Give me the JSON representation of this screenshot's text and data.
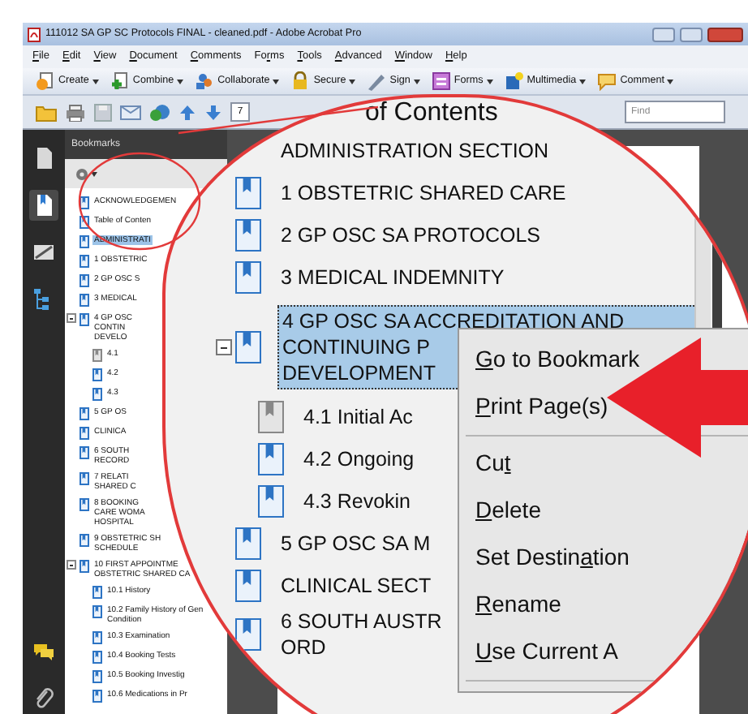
{
  "window": {
    "title": "111012 SA GP SC Protocols FINAL - cleaned.pdf - Adobe Acrobat Pro"
  },
  "menu": [
    {
      "accel_key": "F",
      "text_after": "ile"
    },
    {
      "accel_key": "E",
      "text_after": "dit"
    },
    {
      "accel_key": "V",
      "text_after": "iew"
    },
    {
      "accel_key": "D",
      "text_after": "ocument"
    },
    {
      "accel_key": "C",
      "text_after": "omments"
    },
    {
      "text_before": "Fo",
      "accel_key": "r",
      "text_after": "ms"
    },
    {
      "accel_key": "T",
      "text_after": "ools"
    },
    {
      "accel_key": "A",
      "text_after": "dvanced"
    },
    {
      "accel_key": "W",
      "text_after": "indow"
    },
    {
      "accel_key": "H",
      "text_after": "elp"
    }
  ],
  "toolbar": [
    {
      "label": "Create",
      "kind": "create"
    },
    {
      "label": "Combine",
      "kind": "combine"
    },
    {
      "label": "Collaborate",
      "kind": "collaborate"
    },
    {
      "label": "Secure",
      "kind": "secure"
    },
    {
      "label": "Sign",
      "kind": "sign"
    },
    {
      "label": "Forms",
      "kind": "forms"
    },
    {
      "label": "Multimedia",
      "kind": "multimedia"
    },
    {
      "label": "Comment",
      "kind": "comment"
    }
  ],
  "page_field": {
    "value": "7"
  },
  "find": {
    "placeholder": "Find"
  },
  "nav_panel": [
    {
      "kind": "pages",
      "selected": false
    },
    {
      "kind": "bookmarks",
      "selected": true
    },
    {
      "kind": "signatures",
      "selected": false
    },
    {
      "kind": "layers",
      "selected": false
    },
    {
      "kind": "comments",
      "selected": false
    },
    {
      "kind": "attachments",
      "selected": false
    }
  ],
  "bookmarks_panel": {
    "title": "Bookmarks",
    "items": [
      {
        "label": "ACKNOWLEDGEMEN",
        "kind": "bookmark",
        "selected": false
      },
      {
        "label": "Table of Conten",
        "kind": "bookmark",
        "selected": false
      },
      {
        "label": "ADMINISTRATI",
        "kind": "bookmark",
        "selected": true
      },
      {
        "label": "1 OBSTETRIC",
        "kind": "bookmark",
        "selected": false
      },
      {
        "label": "2 GP OSC S",
        "kind": "bookmark",
        "selected": false
      },
      {
        "label": "3 MEDICAL",
        "kind": "bookmark",
        "selected": false
      },
      {
        "label": "4 GP OSC\nCONTIN\nDEVELO",
        "kind": "bookmark",
        "selected": false,
        "expanded": true,
        "children": [
          {
            "label": "4.1",
            "kind": "dimmed",
            "selected": false
          },
          {
            "label": "4.2",
            "kind": "bookmark",
            "selected": false
          },
          {
            "label": "4.3",
            "kind": "bookmark",
            "selected": false
          }
        ]
      },
      {
        "label": "5 GP OS",
        "kind": "bookmark",
        "selected": false
      },
      {
        "label": "CLINICA",
        "kind": "bookmark",
        "selected": false
      },
      {
        "label": "6 SOUTH\nRECORD",
        "kind": "bookmark",
        "selected": false
      },
      {
        "label": "7 RELATI\nSHARED C",
        "kind": "bookmark",
        "selected": false
      },
      {
        "label": "8 BOOKING\nCARE WOMA\nHOSPITAL",
        "kind": "bookmark",
        "selected": false
      },
      {
        "label": "9 OBSTETRIC SH\nSCHEDULE",
        "kind": "bookmark",
        "selected": false
      },
      {
        "label": "10 FIRST APPOINTME\nOBSTETRIC SHARED CA",
        "kind": "bookmark",
        "selected": false,
        "expanded": true,
        "children": [
          {
            "label": "10.1 History",
            "kind": "bookmark",
            "selected": false
          },
          {
            "label": "10.2 Family History of Gen\nCondition",
            "kind": "bookmark",
            "selected": false
          },
          {
            "label": "10.3 Examination",
            "kind": "bookmark",
            "selected": false
          },
          {
            "label": "10.4 Booking Tests",
            "kind": "bookmark",
            "selected": false
          },
          {
            "label": "10.5 Booking Investig",
            "kind": "bookmark",
            "selected": false
          },
          {
            "label": "10.6 Medications in Pr",
            "kind": "bookmark",
            "selected": false
          }
        ]
      }
    ]
  },
  "magnifier": {
    "heading": "of Contents",
    "items": [
      {
        "label": "ADMINISTRATION SECTION",
        "kind": "none",
        "selected": false
      },
      {
        "label": "1 OBSTETRIC SHARED CARE",
        "kind": "bookmark",
        "selected": false
      },
      {
        "label": "2 GP OSC SA PROTOCOLS",
        "kind": "bookmark",
        "selected": false
      },
      {
        "label": "3 MEDICAL INDEMNITY",
        "kind": "bookmark",
        "selected": false
      },
      {
        "label": "4 GP OSC SA ACCREDITATION AND\nCONTINUING P\nDEVELOPMENT",
        "kind": "bookmark",
        "selected": true,
        "expanded": true,
        "children": [
          {
            "label": "4.1 Initial Ac",
            "kind": "dimmed",
            "selected": false
          },
          {
            "label": "4.2 Ongoing",
            "kind": "bookmark",
            "selected": false
          },
          {
            "label": "4.3 Revokin",
            "kind": "bookmark",
            "selected": false
          }
        ]
      },
      {
        "label": "5 GP OSC SA M",
        "kind": "bookmark",
        "selected": false
      },
      {
        "label": "CLINICAL SECT",
        "kind": "bookmark",
        "selected": false
      },
      {
        "label": "6 SOUTH AUSTR\nORD",
        "kind": "bookmark",
        "selected": false
      }
    ],
    "context_menu": [
      {
        "kind": "command",
        "accel_key": "G",
        "text_after": "o to Bookmark"
      },
      {
        "kind": "command",
        "accel_key": "P",
        "text_after": "rint Page(s)"
      },
      {
        "kind": "separator"
      },
      {
        "kind": "command",
        "text_before": "Cu",
        "accel_key": "t"
      },
      {
        "kind": "command",
        "accel_key": "D",
        "text_after": "elete"
      },
      {
        "kind": "command",
        "text_before": "Set Destin",
        "accel_key": "a",
        "text_after": "tion"
      },
      {
        "kind": "command",
        "accel_key": "R",
        "text_after": "ename"
      },
      {
        "kind": "command",
        "accel_key": "U",
        "text_after": "se Current A"
      },
      {
        "kind": "separator"
      }
    ]
  }
}
